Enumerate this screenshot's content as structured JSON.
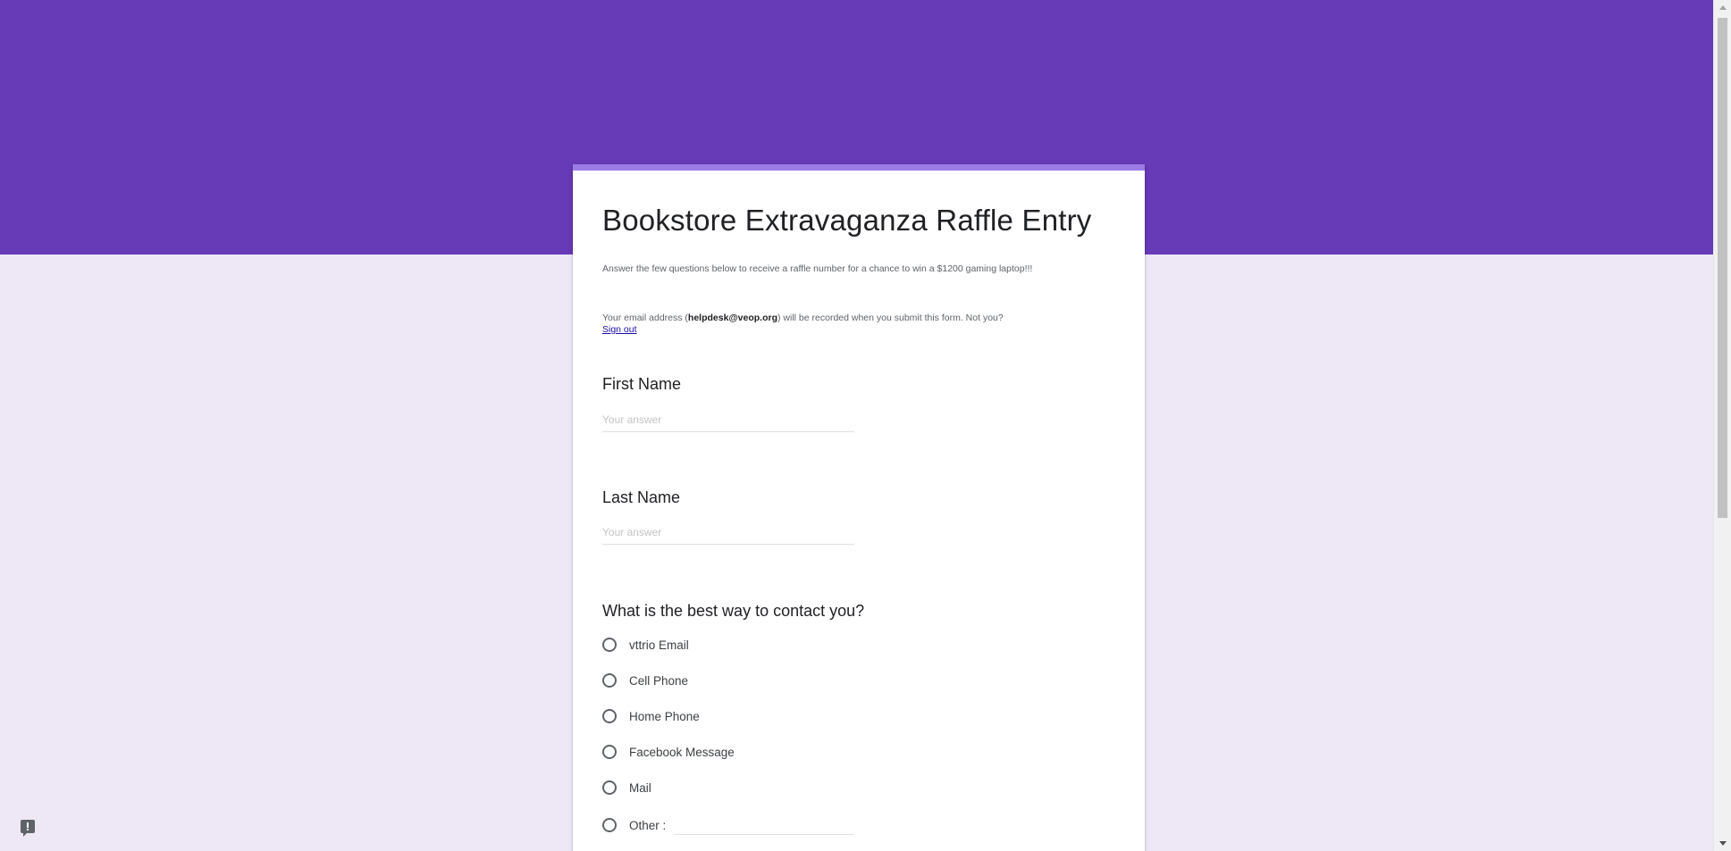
{
  "form": {
    "title": "Bookstore Extravaganza Raffle Entry",
    "description": "Answer the few questions below to receive a raffle number for a chance to win a $1200 gaming laptop!!!",
    "email_note_prefix": "Your email address (",
    "email_address": "helpdesk@veop.org",
    "email_note_suffix": ") will be recorded when you submit this form. Not you?",
    "sign_out_label": "Sign out"
  },
  "questions": {
    "first_name": {
      "label": "First Name",
      "placeholder": "Your answer"
    },
    "last_name": {
      "label": "Last Name",
      "placeholder": "Your answer"
    },
    "contact": {
      "label": "What is the best way to contact you?",
      "options": [
        "vttrio Email",
        "Cell Phone",
        "Home Phone",
        "Facebook Message",
        "Mail",
        "Other :"
      ]
    }
  },
  "colors": {
    "header": "#673ab7",
    "background": "#ede7f6",
    "card_accent": "#9c7ce6",
    "link": "#1a0dab"
  },
  "icons": {
    "feedback": "feedback-icon"
  }
}
